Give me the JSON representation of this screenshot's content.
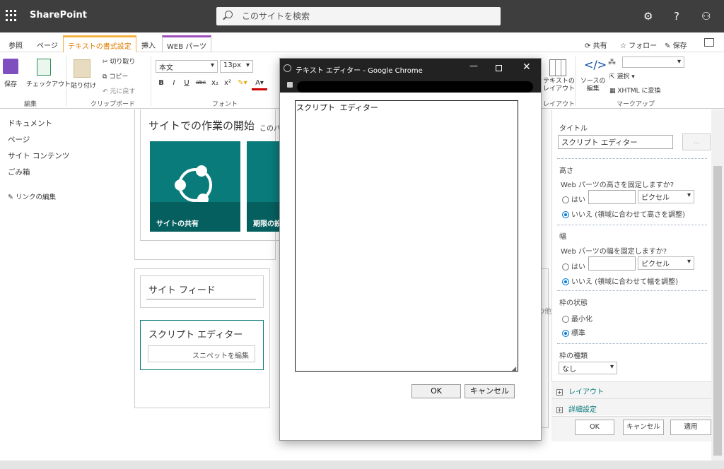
{
  "suitebar": {
    "brand": "SharePoint",
    "search_placeholder": "このサイトを検索",
    "icons": [
      "waffle-icon",
      "gear-icon",
      "help-icon",
      "person-icon"
    ],
    "settings_glyph": "⚙",
    "help_glyph": "?",
    "person_glyph": "⚇"
  },
  "ribbon_tabs": [
    "参照",
    "ページ",
    "テキストの書式設定",
    "挿入",
    "WEB パーツ"
  ],
  "ribbon_right": {
    "share": "共有",
    "follow": "フォロー",
    "save": "保存"
  },
  "ribbon": {
    "save": "保存",
    "checkout": "チェックアウト",
    "paste": "貼り付け",
    "cut": "切り取り",
    "copy": "コピー",
    "undo": "元に戻す",
    "font_name": "本文",
    "font_size": "13px",
    "format_buttons": [
      "B",
      "I",
      "U",
      "abc",
      "x₂",
      "x²"
    ],
    "groups": {
      "edit": "編集",
      "clipboard": "クリップボード",
      "font": "フォント",
      "layout": "レイアウト",
      "markup": "マークアップ"
    },
    "text_layout_1": "テキストの",
    "text_layout_2": "レイアウト",
    "source_1": "ソースの",
    "source_2": "編集",
    "select": "選択",
    "xhtml": "XHTML に変換"
  },
  "leftnav": [
    "ドキュメント",
    "ページ",
    "サイト コンテンツ",
    "ごみ箱"
  ],
  "leftnav_edit": "リンクの編集",
  "canvas": {
    "getting_started": "サイトでの作業の開始",
    "getting_started_sub": "このパ",
    "tile1": "サイトの共有",
    "tile2": "期限の設",
    "site_feed": "サイト フィード",
    "script_editor": "スクリプト エディター",
    "edit_snippet": "スニペットを編集",
    "other": "その他"
  },
  "dialog": {
    "title": "テキスト エディター - Google Chrome",
    "text": "スクリプト エディター",
    "ok": "OK",
    "cancel": "キャンセル"
  },
  "pane": {
    "title_label": "タイトル",
    "title_value": "スクリプト エディター",
    "browse": "...",
    "height_label": "高さ",
    "height_q": "Web パーツの高さを固定しますか?",
    "yes": "はい",
    "unit": "ピクセル",
    "height_no": "いいえ (領域に合わせて高さを調整)",
    "width_label": "幅",
    "width_q": "Web パーツの幅を固定しますか?",
    "width_no": "いいえ (領域に合わせて幅を調整)",
    "chrome_state": "枠の状態",
    "minimize": "最小化",
    "normal": "標準",
    "chrome_type": "枠の種類",
    "chrome_type_value": "なし",
    "layout": "レイアウト",
    "advanced": "詳細設定",
    "ok": "OK",
    "cancel": "キャンセル",
    "apply": "適用"
  },
  "colors": {
    "teal": "#0a7b7b",
    "accent_orange": "#e17c00",
    "webpart_purple": "#9e4ebe",
    "link_teal": "#0a7b7b"
  }
}
